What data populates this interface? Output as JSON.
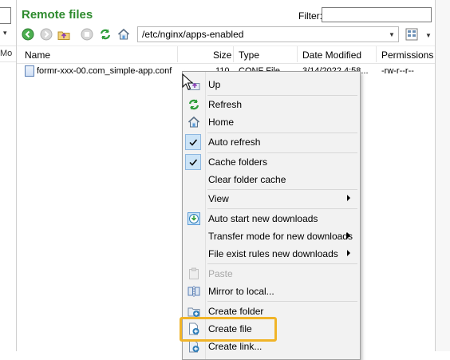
{
  "title": "Remote files",
  "filter": {
    "label": "Filter:",
    "value": ""
  },
  "toolbar": {
    "path": "/etc/nginx/apps-enabled",
    "icons": [
      "back-icon",
      "forward-icon",
      "parent-folder-icon",
      "stop-icon",
      "refresh-icon",
      "home-icon",
      "view-mode-icon"
    ]
  },
  "left_pane": {
    "column_fragment": "Mo"
  },
  "columns": [
    "Name",
    "Size",
    "Type",
    "Date Modified",
    "Permissions"
  ],
  "files": [
    {
      "name": "formr-xxx-00.com_simple-app.conf",
      "size": "110",
      "type": "CONF File",
      "date": "3/14/2022 4:58...",
      "permissions": "-rw-r--r--"
    }
  ],
  "menu": {
    "items": [
      {
        "label": "Up",
        "icon": "up-folder-icon",
        "enabled": true
      },
      {
        "label": "Refresh",
        "icon": "refresh-icon",
        "enabled": true
      },
      {
        "label": "Home",
        "icon": "home-icon",
        "enabled": true
      },
      {
        "label": "Auto refresh",
        "checked": true,
        "enabled": true
      },
      {
        "label": "Cache folders",
        "checked": true,
        "enabled": true
      },
      {
        "label": "Clear folder cache",
        "enabled": true
      },
      {
        "label": "View",
        "submenu": true,
        "enabled": true
      },
      {
        "label": "Auto start new downloads",
        "icon": "auto-start-icon",
        "enabled": true
      },
      {
        "label": "Transfer mode for new downloads",
        "submenu": true,
        "enabled": true
      },
      {
        "label": "File exist rules new downloads",
        "submenu": true,
        "enabled": true
      },
      {
        "label": "Paste",
        "icon": "paste-icon",
        "enabled": false
      },
      {
        "label": "Mirror to local...",
        "icon": "mirror-icon",
        "enabled": true
      },
      {
        "label": "Create folder",
        "icon": "create-folder-icon",
        "enabled": true
      },
      {
        "label": "Create file",
        "icon": "create-file-icon",
        "enabled": true,
        "highlighted": true
      },
      {
        "label": "Create link...",
        "icon": "create-link-icon",
        "enabled": true
      }
    ]
  },
  "colors": {
    "title": "#2e8b2e",
    "highlight": "#f0b428",
    "check_bg": "#cce4f7"
  }
}
